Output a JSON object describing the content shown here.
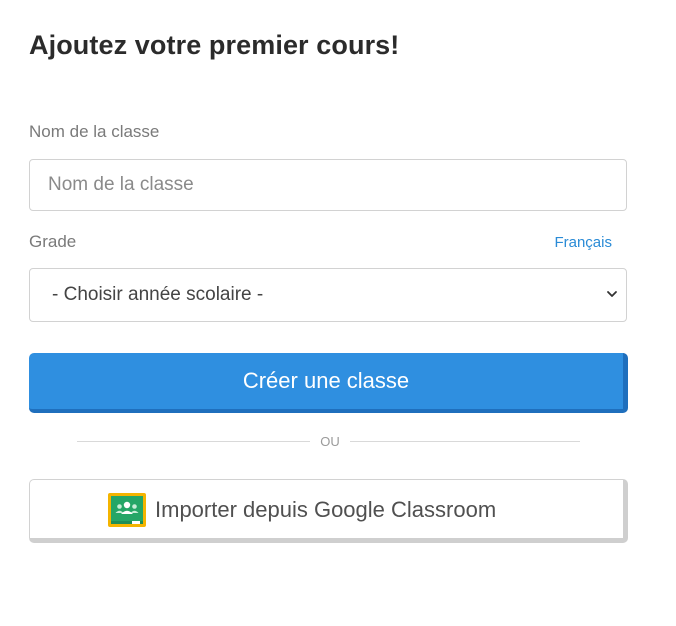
{
  "form": {
    "title": "Ajoutez votre premier cours!",
    "class_name": {
      "label": "Nom de la classe",
      "placeholder": "Nom de la classe",
      "value": ""
    },
    "grade": {
      "label": "Grade",
      "selected": "- Choisir année scolaire -"
    },
    "language_link": "Français",
    "create_button": "Créer une classe",
    "divider_text": "OU",
    "google_button": {
      "label": "Importer depuis Google Classroom",
      "icon": "google-classroom-icon"
    }
  },
  "colors": {
    "primary": "#2f8fe0",
    "primary_shadow": "#1f6fbd",
    "link": "#2a8bd6",
    "classroom_green": "#25a667",
    "classroom_yellow": "#f4b400"
  }
}
